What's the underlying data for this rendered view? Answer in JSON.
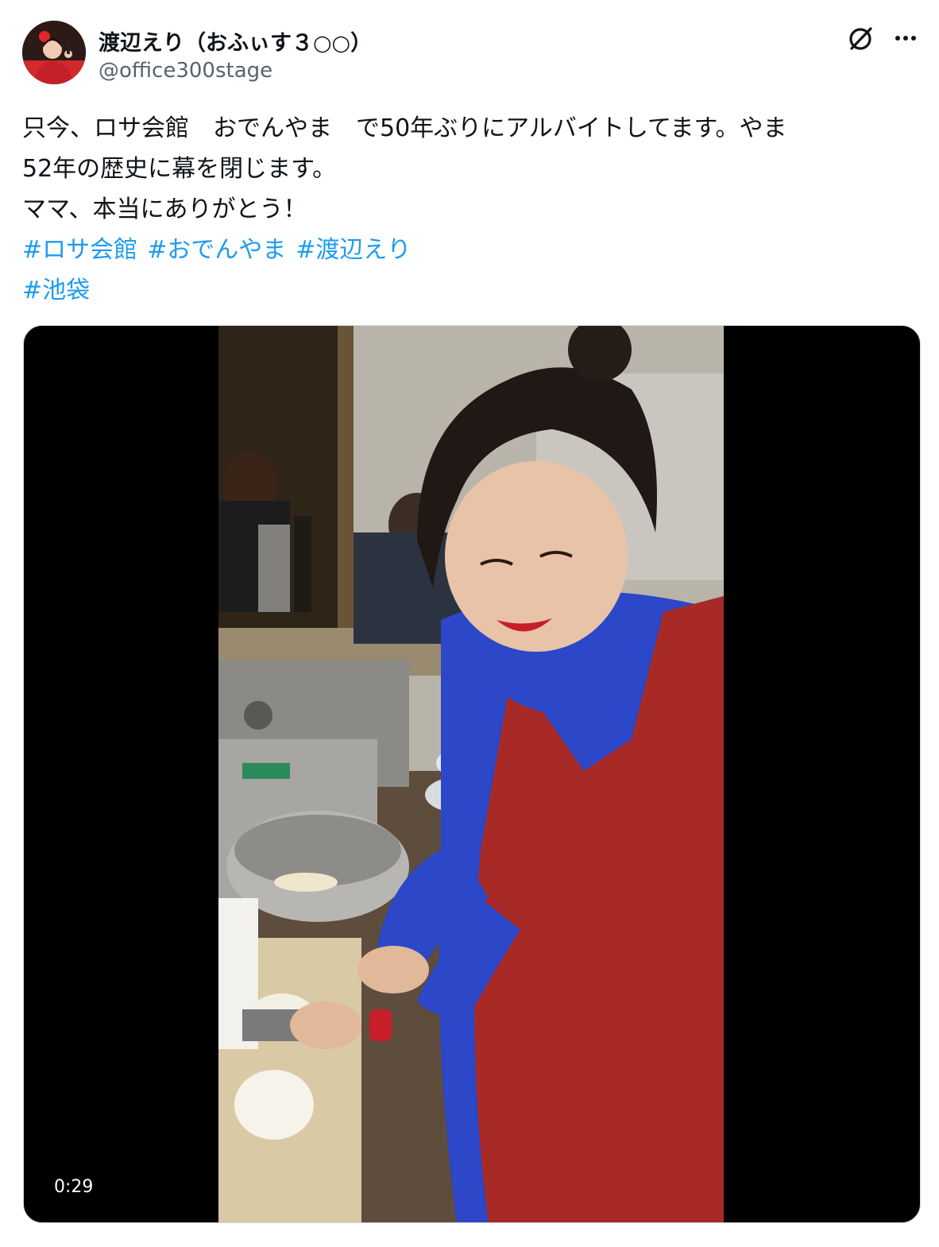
{
  "author": {
    "display_name": "渡辺えり（おふぃす３○○）",
    "handle": "@office300stage",
    "avatar_icon": "profile-photo"
  },
  "header_icons": {
    "grok": "grok-icon",
    "more": "more-icon"
  },
  "tweet": {
    "lines": [
      "只今、ロサ会館　おでんやま　で50年ぶりにアルバイトしてます。やま",
      "52年の歴史に幕を閉じます。",
      "ママ、本当にありがとう！"
    ],
    "hashtags_line1": [
      "#ロサ会館",
      "#おでんやま",
      "#渡辺えり"
    ],
    "hashtags_line2": [
      "#池袋"
    ]
  },
  "media": {
    "type": "video",
    "duration": "0:29"
  },
  "colors": {
    "link": "#1d9bf0",
    "secondary_text": "#536471",
    "primary_text": "#0f1419"
  }
}
